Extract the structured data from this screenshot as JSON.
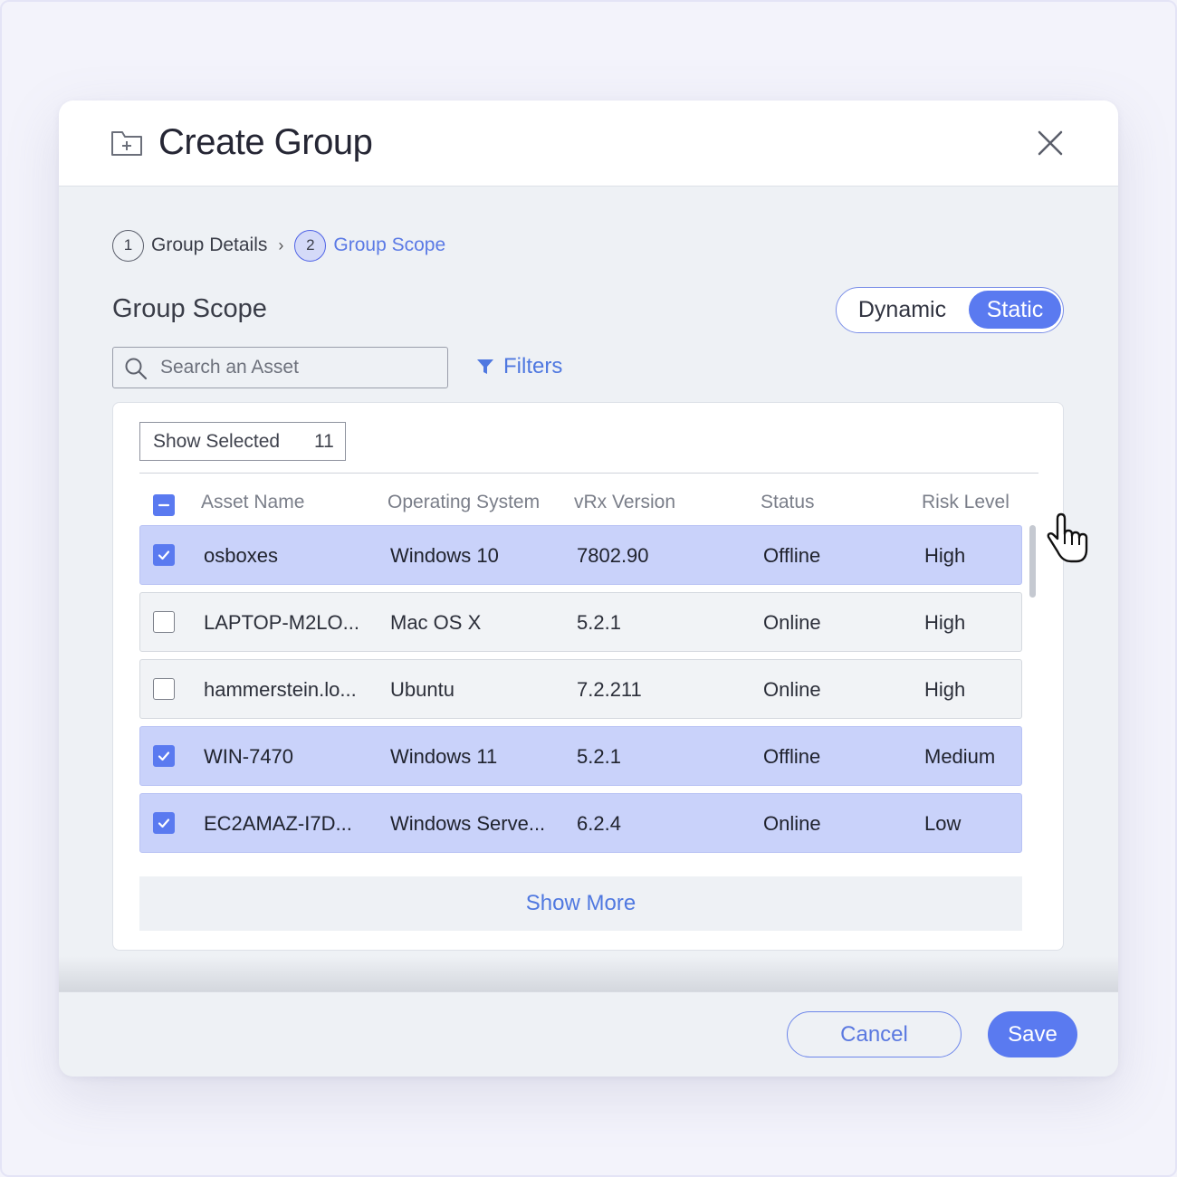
{
  "dialog": {
    "title": "Create Group",
    "icons": {
      "title": "folder-plus-icon",
      "close": "close-icon"
    }
  },
  "steps": [
    {
      "number": "1",
      "label": "Group Details",
      "state": "completed"
    },
    {
      "number": "2",
      "label": "Group Scope",
      "state": "active"
    }
  ],
  "scope": {
    "title": "Group Scope",
    "toggle": {
      "options": [
        "Dynamic",
        "Static"
      ],
      "selected": "Static"
    },
    "search": {
      "placeholder": "Search an Asset",
      "value": ""
    },
    "filters_label": "Filters",
    "show_selected": {
      "label": "Show Selected",
      "count": "11"
    }
  },
  "table": {
    "select_all_state": "partial",
    "columns": [
      "Asset Name",
      "Operating System",
      "vRx Version",
      "Status",
      "Risk Level"
    ],
    "rows": [
      {
        "checked": true,
        "cells": [
          "osboxes",
          "Windows 10",
          "7802.90",
          "Offline",
          "High"
        ]
      },
      {
        "checked": false,
        "cells": [
          "LAPTOP-M2LO...",
          "Mac OS X",
          "5.2.1",
          "Online",
          "High"
        ]
      },
      {
        "checked": false,
        "cells": [
          "hammerstein.lo...",
          "Ubuntu",
          "7.2.211",
          "Online",
          "High"
        ]
      },
      {
        "checked": true,
        "cells": [
          "WIN-7470",
          "Windows 11",
          "5.2.1",
          "Offline",
          "Medium"
        ]
      },
      {
        "checked": true,
        "cells": [
          "EC2AMAZ-I7D...",
          "Windows Serve...",
          "6.2.4",
          "Online",
          "Low"
        ]
      }
    ],
    "show_more_label": "Show More"
  },
  "footer": {
    "cancel_label": "Cancel",
    "save_label": "Save"
  },
  "colors": {
    "accent": "#5a7af0",
    "link": "#4f78e0",
    "selected_row": "#c9d2fa",
    "background": "#eef1f5"
  }
}
